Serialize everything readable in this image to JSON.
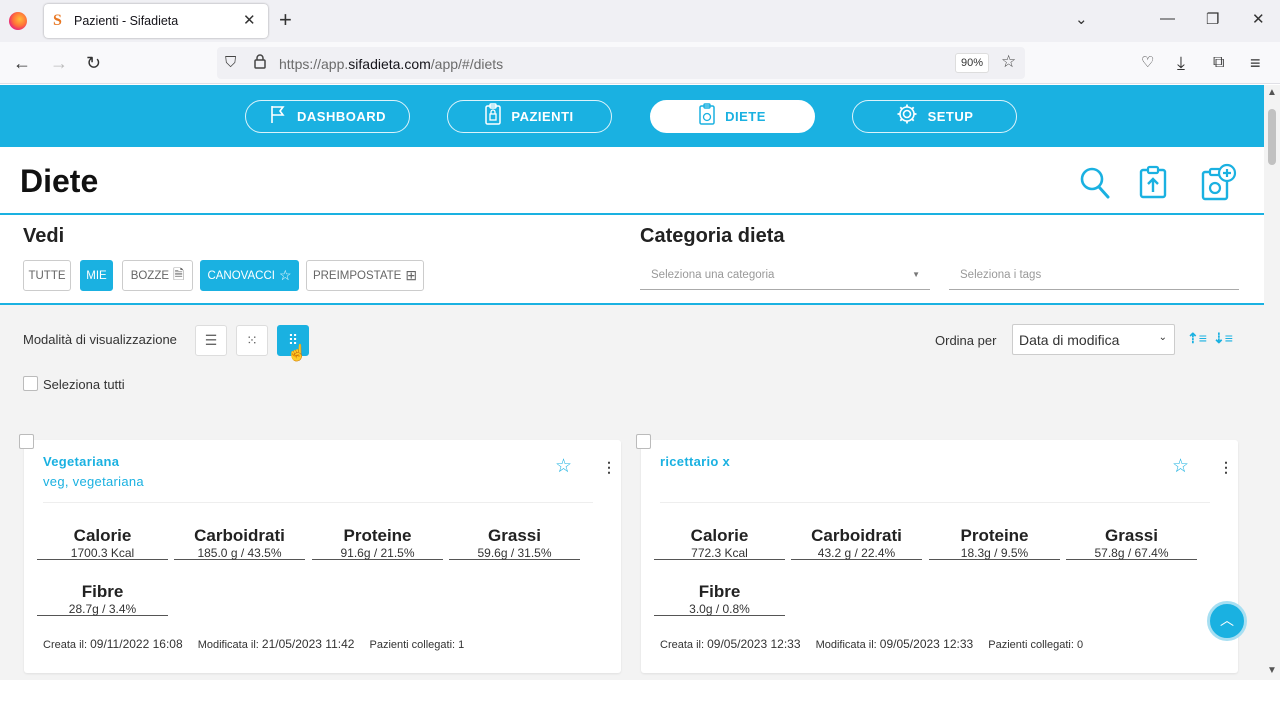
{
  "browser": {
    "tab_title": "Pazienti - Sifadieta",
    "url_prefix": "https://app.",
    "url_domain": "sifadieta.com",
    "url_path": "/app/#/diets",
    "zoom": "90%"
  },
  "nav": [
    {
      "label": "DASHBOARD",
      "icon": "flag-icon"
    },
    {
      "label": "PAZIENTI",
      "icon": "clipboard-lock-icon"
    },
    {
      "label": "DIETE",
      "icon": "clipboard-apple-icon"
    },
    {
      "label": "SETUP",
      "icon": "gear-icon"
    }
  ],
  "page_title": "Diete",
  "filters": {
    "vedi_title": "Vedi",
    "buttons": [
      "TUTTE",
      "MIE",
      "BOZZE",
      "CANOVACCI",
      "PREIMPOSTATE"
    ],
    "category_title": "Categoria dieta",
    "category_placeholder": "Seleziona una categoria",
    "tags_placeholder": "Seleziona i tags"
  },
  "view": {
    "label": "Modalità di visualizzazione",
    "sort_label": "Ordina per",
    "sort_value": "Data di modifica",
    "select_all": "Seleziona tutti"
  },
  "cards": [
    {
      "title": "Vegetariana",
      "subtitle": "veg, vegetariana",
      "nutrients": [
        {
          "name": "Calorie",
          "value": "1700.3 Kcal"
        },
        {
          "name": "Carboidrati",
          "value": "185.0 g / 43.5%"
        },
        {
          "name": "Proteine",
          "value": "91.6g / 21.5%"
        },
        {
          "name": "Grassi",
          "value": "59.6g / 31.5%"
        },
        {
          "name": "Fibre",
          "value": "28.7g / 3.4%"
        }
      ],
      "created_label": "Creata il:",
      "created": "09/11/2022 16:08",
      "modified_label": "Modificata il:",
      "modified": "21/05/2023 11:42",
      "patients_label": "Pazienti collegati:",
      "patients": "1"
    },
    {
      "title": "ricettario x",
      "subtitle": "",
      "nutrients": [
        {
          "name": "Calorie",
          "value": "772.3 Kcal"
        },
        {
          "name": "Carboidrati",
          "value": "43.2 g / 22.4%"
        },
        {
          "name": "Proteine",
          "value": "18.3g / 9.5%"
        },
        {
          "name": "Grassi",
          "value": "57.8g / 67.4%"
        },
        {
          "name": "Fibre",
          "value": "3.0g / 0.8%"
        }
      ],
      "created_label": "Creata il:",
      "created": "09/05/2023 12:33",
      "modified_label": "Modificata il:",
      "modified": "09/05/2023 12:33",
      "patients_label": "Pazienti collegati:",
      "patients": "0"
    }
  ],
  "colors": {
    "accent": "#1ab1e1"
  }
}
